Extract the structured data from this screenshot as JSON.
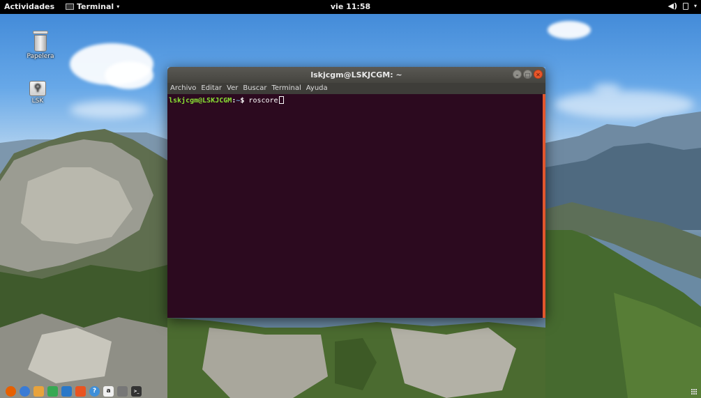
{
  "topbar": {
    "activities": "Actividades",
    "app_menu": "Terminal",
    "app_menu_arrow": "▾",
    "clock": "vie 11:58",
    "tray_icons": [
      "volume-icon",
      "battery-icon",
      "system-menu-arrow-icon"
    ],
    "tray_volume": "◀)",
    "tray_battery": "🔋",
    "tray_arrow": "▾"
  },
  "desktop": {
    "icons": [
      {
        "label": "Papelera",
        "icon": "trash-icon"
      },
      {
        "label": "LSK",
        "icon": "usb-drive-icon"
      }
    ]
  },
  "terminal": {
    "title": "lskjcgm@LSKJCGM: ~",
    "menu": [
      "Archivo",
      "Editar",
      "Ver",
      "Buscar",
      "Terminal",
      "Ayuda"
    ],
    "prompt_user": "lskjcgm@LSKJCGM",
    "prompt_sep": ":",
    "prompt_path": "~",
    "prompt_dollar": "$ ",
    "command": "roscore",
    "window_buttons": {
      "minimize": "–",
      "maximize": "□",
      "close": "✕"
    }
  },
  "dock": {
    "items": [
      {
        "name": "firefox-icon",
        "color": "#e66000"
      },
      {
        "name": "chromium-icon",
        "color": "#3a7bd5"
      },
      {
        "name": "files-icon",
        "color": "#e8a33c"
      },
      {
        "name": "libreoffice-calc-icon",
        "color": "#36a852"
      },
      {
        "name": "libreoffice-writer-icon",
        "color": "#2a78c8"
      },
      {
        "name": "software-center-icon",
        "color": "#e95420"
      },
      {
        "name": "help-icon",
        "color": "#3f8fd8"
      },
      {
        "name": "amazon-icon",
        "color": "#f0f0f0"
      },
      {
        "name": "settings-icon",
        "color": "#777777"
      },
      {
        "name": "terminal-icon",
        "color": "#333333"
      }
    ],
    "glyphs": {
      "help-icon": "?",
      "amazon-icon": "a",
      "terminal-icon": ">_"
    }
  },
  "colors": {
    "terminal_bg": "#2c0a1f",
    "prompt_user": "#8ae234",
    "prompt_path": "#729fcf",
    "accent": "#e95420"
  }
}
